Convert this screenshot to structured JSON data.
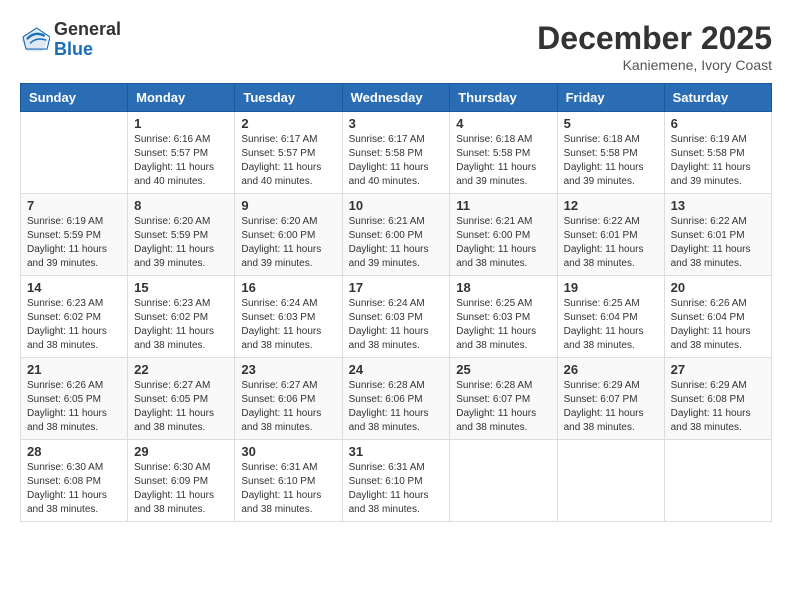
{
  "logo": {
    "general": "General",
    "blue": "Blue"
  },
  "header": {
    "month": "December 2025",
    "location": "Kaniemene, Ivory Coast"
  },
  "weekdays": [
    "Sunday",
    "Monday",
    "Tuesday",
    "Wednesday",
    "Thursday",
    "Friday",
    "Saturday"
  ],
  "weeks": [
    [
      {
        "day": "",
        "sunrise": "",
        "sunset": "",
        "daylight": ""
      },
      {
        "day": "1",
        "sunrise": "Sunrise: 6:16 AM",
        "sunset": "Sunset: 5:57 PM",
        "daylight": "Daylight: 11 hours and 40 minutes."
      },
      {
        "day": "2",
        "sunrise": "Sunrise: 6:17 AM",
        "sunset": "Sunset: 5:57 PM",
        "daylight": "Daylight: 11 hours and 40 minutes."
      },
      {
        "day": "3",
        "sunrise": "Sunrise: 6:17 AM",
        "sunset": "Sunset: 5:58 PM",
        "daylight": "Daylight: 11 hours and 40 minutes."
      },
      {
        "day": "4",
        "sunrise": "Sunrise: 6:18 AM",
        "sunset": "Sunset: 5:58 PM",
        "daylight": "Daylight: 11 hours and 39 minutes."
      },
      {
        "day": "5",
        "sunrise": "Sunrise: 6:18 AM",
        "sunset": "Sunset: 5:58 PM",
        "daylight": "Daylight: 11 hours and 39 minutes."
      },
      {
        "day": "6",
        "sunrise": "Sunrise: 6:19 AM",
        "sunset": "Sunset: 5:58 PM",
        "daylight": "Daylight: 11 hours and 39 minutes."
      }
    ],
    [
      {
        "day": "7",
        "sunrise": "Sunrise: 6:19 AM",
        "sunset": "Sunset: 5:59 PM",
        "daylight": "Daylight: 11 hours and 39 minutes."
      },
      {
        "day": "8",
        "sunrise": "Sunrise: 6:20 AM",
        "sunset": "Sunset: 5:59 PM",
        "daylight": "Daylight: 11 hours and 39 minutes."
      },
      {
        "day": "9",
        "sunrise": "Sunrise: 6:20 AM",
        "sunset": "Sunset: 6:00 PM",
        "daylight": "Daylight: 11 hours and 39 minutes."
      },
      {
        "day": "10",
        "sunrise": "Sunrise: 6:21 AM",
        "sunset": "Sunset: 6:00 PM",
        "daylight": "Daylight: 11 hours and 39 minutes."
      },
      {
        "day": "11",
        "sunrise": "Sunrise: 6:21 AM",
        "sunset": "Sunset: 6:00 PM",
        "daylight": "Daylight: 11 hours and 38 minutes."
      },
      {
        "day": "12",
        "sunrise": "Sunrise: 6:22 AM",
        "sunset": "Sunset: 6:01 PM",
        "daylight": "Daylight: 11 hours and 38 minutes."
      },
      {
        "day": "13",
        "sunrise": "Sunrise: 6:22 AM",
        "sunset": "Sunset: 6:01 PM",
        "daylight": "Daylight: 11 hours and 38 minutes."
      }
    ],
    [
      {
        "day": "14",
        "sunrise": "Sunrise: 6:23 AM",
        "sunset": "Sunset: 6:02 PM",
        "daylight": "Daylight: 11 hours and 38 minutes."
      },
      {
        "day": "15",
        "sunrise": "Sunrise: 6:23 AM",
        "sunset": "Sunset: 6:02 PM",
        "daylight": "Daylight: 11 hours and 38 minutes."
      },
      {
        "day": "16",
        "sunrise": "Sunrise: 6:24 AM",
        "sunset": "Sunset: 6:03 PM",
        "daylight": "Daylight: 11 hours and 38 minutes."
      },
      {
        "day": "17",
        "sunrise": "Sunrise: 6:24 AM",
        "sunset": "Sunset: 6:03 PM",
        "daylight": "Daylight: 11 hours and 38 minutes."
      },
      {
        "day": "18",
        "sunrise": "Sunrise: 6:25 AM",
        "sunset": "Sunset: 6:03 PM",
        "daylight": "Daylight: 11 hours and 38 minutes."
      },
      {
        "day": "19",
        "sunrise": "Sunrise: 6:25 AM",
        "sunset": "Sunset: 6:04 PM",
        "daylight": "Daylight: 11 hours and 38 minutes."
      },
      {
        "day": "20",
        "sunrise": "Sunrise: 6:26 AM",
        "sunset": "Sunset: 6:04 PM",
        "daylight": "Daylight: 11 hours and 38 minutes."
      }
    ],
    [
      {
        "day": "21",
        "sunrise": "Sunrise: 6:26 AM",
        "sunset": "Sunset: 6:05 PM",
        "daylight": "Daylight: 11 hours and 38 minutes."
      },
      {
        "day": "22",
        "sunrise": "Sunrise: 6:27 AM",
        "sunset": "Sunset: 6:05 PM",
        "daylight": "Daylight: 11 hours and 38 minutes."
      },
      {
        "day": "23",
        "sunrise": "Sunrise: 6:27 AM",
        "sunset": "Sunset: 6:06 PM",
        "daylight": "Daylight: 11 hours and 38 minutes."
      },
      {
        "day": "24",
        "sunrise": "Sunrise: 6:28 AM",
        "sunset": "Sunset: 6:06 PM",
        "daylight": "Daylight: 11 hours and 38 minutes."
      },
      {
        "day": "25",
        "sunrise": "Sunrise: 6:28 AM",
        "sunset": "Sunset: 6:07 PM",
        "daylight": "Daylight: 11 hours and 38 minutes."
      },
      {
        "day": "26",
        "sunrise": "Sunrise: 6:29 AM",
        "sunset": "Sunset: 6:07 PM",
        "daylight": "Daylight: 11 hours and 38 minutes."
      },
      {
        "day": "27",
        "sunrise": "Sunrise: 6:29 AM",
        "sunset": "Sunset: 6:08 PM",
        "daylight": "Daylight: 11 hours and 38 minutes."
      }
    ],
    [
      {
        "day": "28",
        "sunrise": "Sunrise: 6:30 AM",
        "sunset": "Sunset: 6:08 PM",
        "daylight": "Daylight: 11 hours and 38 minutes."
      },
      {
        "day": "29",
        "sunrise": "Sunrise: 6:30 AM",
        "sunset": "Sunset: 6:09 PM",
        "daylight": "Daylight: 11 hours and 38 minutes."
      },
      {
        "day": "30",
        "sunrise": "Sunrise: 6:31 AM",
        "sunset": "Sunset: 6:10 PM",
        "daylight": "Daylight: 11 hours and 38 minutes."
      },
      {
        "day": "31",
        "sunrise": "Sunrise: 6:31 AM",
        "sunset": "Sunset: 6:10 PM",
        "daylight": "Daylight: 11 hours and 38 minutes."
      },
      {
        "day": "",
        "sunrise": "",
        "sunset": "",
        "daylight": ""
      },
      {
        "day": "",
        "sunrise": "",
        "sunset": "",
        "daylight": ""
      },
      {
        "day": "",
        "sunrise": "",
        "sunset": "",
        "daylight": ""
      }
    ]
  ]
}
